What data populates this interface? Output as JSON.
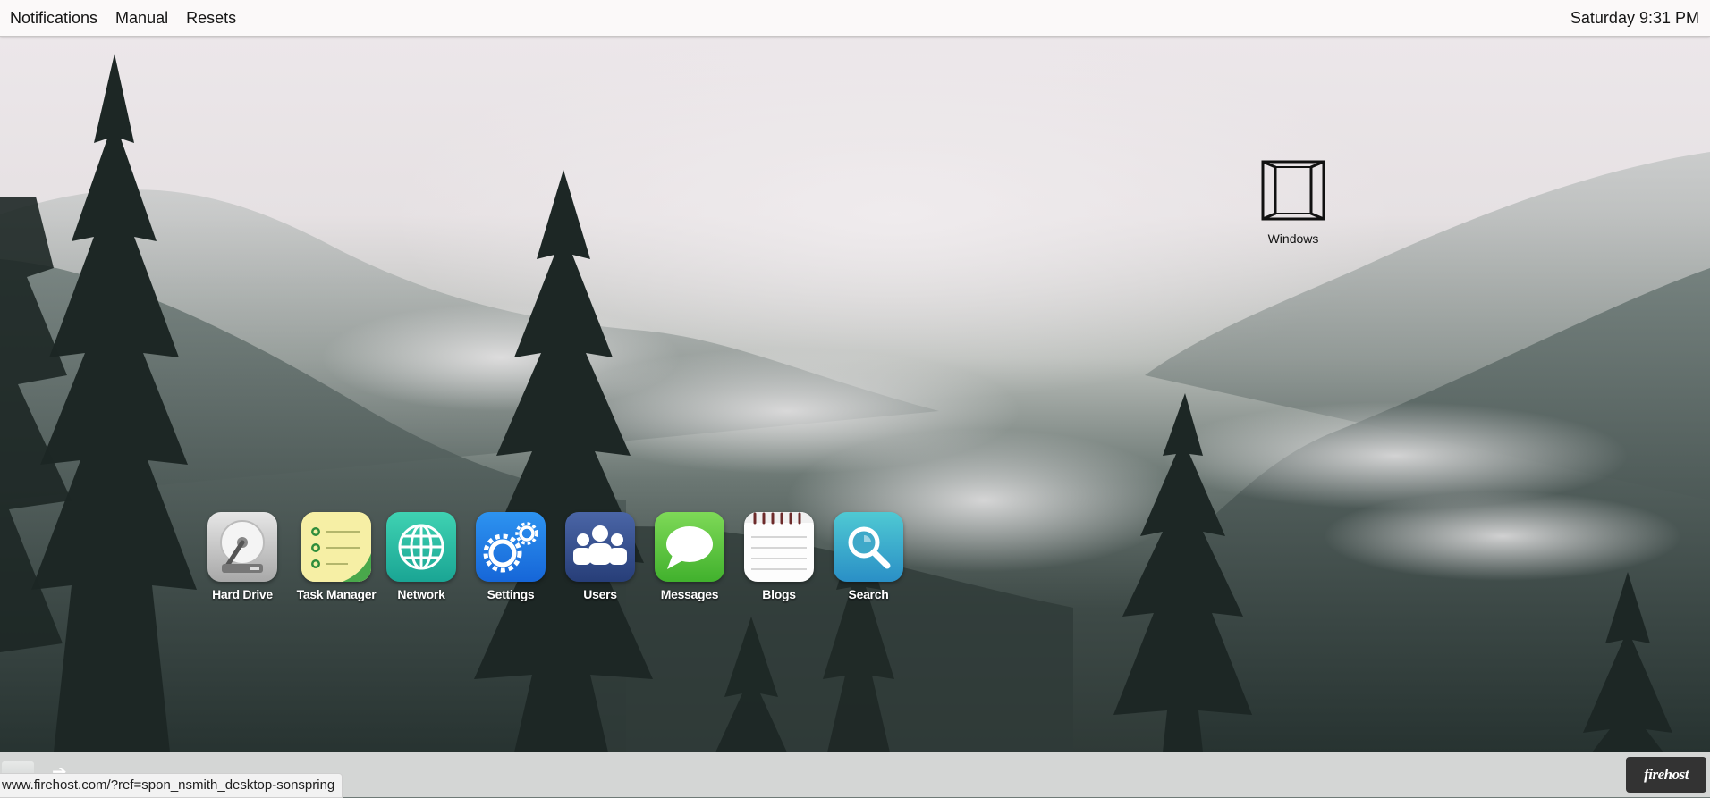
{
  "menubar": {
    "items": [
      "Notifications",
      "Manual",
      "Resets"
    ],
    "clock": "Saturday 9:31 PM"
  },
  "desktop": {
    "windows_icon": {
      "label": "Windows",
      "icon": "window-icon"
    },
    "apps": [
      {
        "label": "Hard Drive",
        "icon": "hard-drive-icon"
      },
      {
        "label": "Task Manager",
        "icon": "task-list-icon"
      },
      {
        "label": "Network",
        "icon": "globe-icon"
      },
      {
        "label": "Settings",
        "icon": "gears-icon"
      },
      {
        "label": "Users",
        "icon": "users-icon"
      },
      {
        "label": "Messages",
        "icon": "speech-bubble-icon"
      },
      {
        "label": "Blogs",
        "icon": "notepad-icon"
      },
      {
        "label": "Search",
        "icon": "magnifier-icon"
      }
    ]
  },
  "taskbar": {
    "status_url": "www.firehost.com/?ref=spon_nsmith_desktop-sonspring",
    "badge": "firehost"
  }
}
